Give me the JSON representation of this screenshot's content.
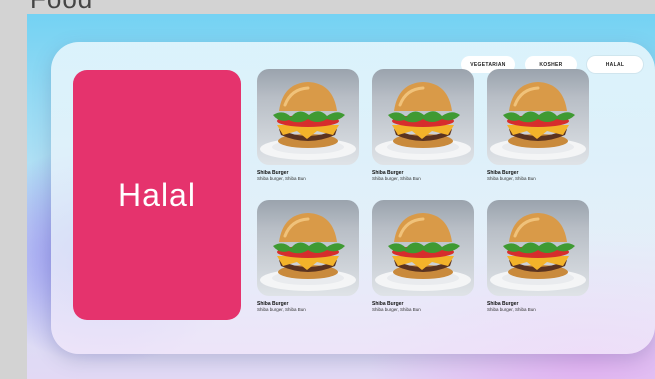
{
  "frame": {
    "title": "Food"
  },
  "tabs": [
    {
      "label": "VEGETARIAN"
    },
    {
      "label": "KOSHER"
    },
    {
      "label": "HALAL",
      "selected": true
    }
  ],
  "hero": {
    "label": "Halal",
    "color": "#e5336d"
  },
  "items": [
    {
      "name": "Shiba Burger",
      "desc": "Shiba burger, Shiba Bun",
      "icon": "burger-image"
    },
    {
      "name": "Shiba Burger",
      "desc": "Shiba burger, Shiba Bun",
      "icon": "burger-image"
    },
    {
      "name": "Shiba Burger",
      "desc": "Shiba burger, Shiba Bun",
      "icon": "burger-image"
    },
    {
      "name": "Shiba Burger",
      "desc": "Shiba burger, Shiba Bun",
      "icon": "burger-image"
    },
    {
      "name": "Shiba Burger",
      "desc": "Shiba burger, Shiba Bun",
      "icon": "burger-image"
    },
    {
      "name": "Shiba Burger",
      "desc": "Shiba burger, Shiba Bun",
      "icon": "burger-image"
    }
  ]
}
